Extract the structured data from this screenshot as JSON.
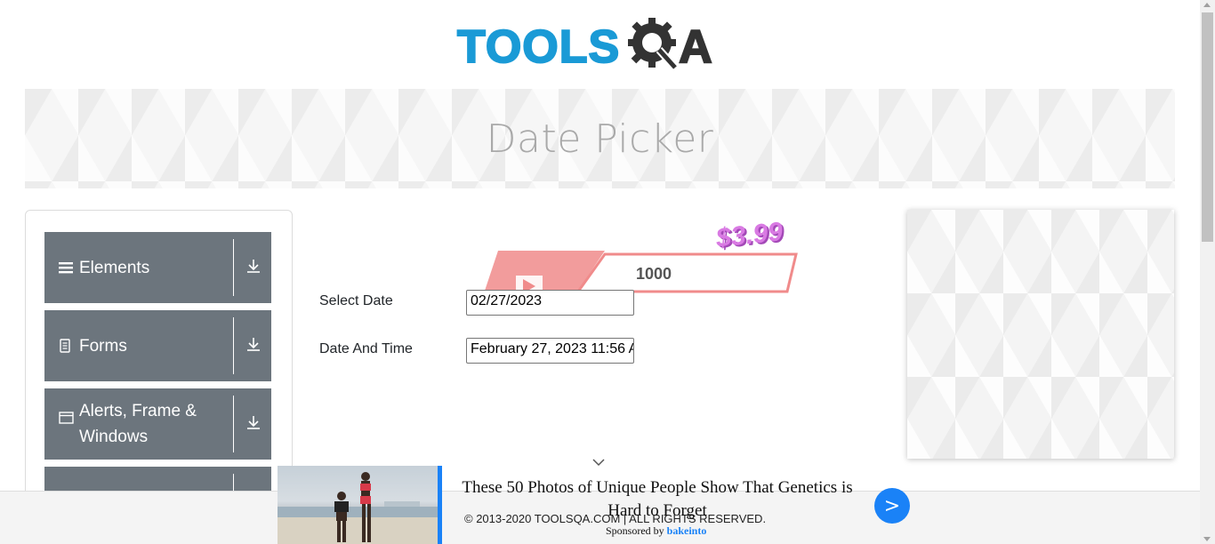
{
  "logo": {
    "text_primary": "TOOLS",
    "text_secondary": "A",
    "icon": "gear-magnifier-icon",
    "primary_color": "#1a9ad6",
    "secondary_color": "#333333"
  },
  "banner": {
    "title": "Date Picker"
  },
  "sidebar": {
    "groups": [
      {
        "label": "Elements",
        "icon": "hamburger-icon"
      },
      {
        "label": "Forms",
        "icon": "document-icon"
      },
      {
        "label": "Alerts, Frame & Windows",
        "icon": "window-icon"
      },
      {
        "label": "",
        "icon": ""
      }
    ],
    "group_color": "#6c757d"
  },
  "top_ad": {
    "price": "$3.99",
    "views": "1000"
  },
  "form": {
    "select_date_label": "Select Date",
    "select_date_value": "02/27/2023",
    "date_time_label": "Date And Time",
    "date_time_value": "February 27, 2023 11:56 A"
  },
  "bottom_ad": {
    "headline": "These 50 Photos of Unique People Show That Genetics is Hard to Forget",
    "button_label": ">",
    "sponsored_prefix": "Sponsored by",
    "sponsor": "bakeinto",
    "accent_color": "#1a82f7"
  },
  "footer": {
    "copyright": "© 2013-2020 TOOLSQA.COM | ALL RIGHTS RESERVED."
  }
}
